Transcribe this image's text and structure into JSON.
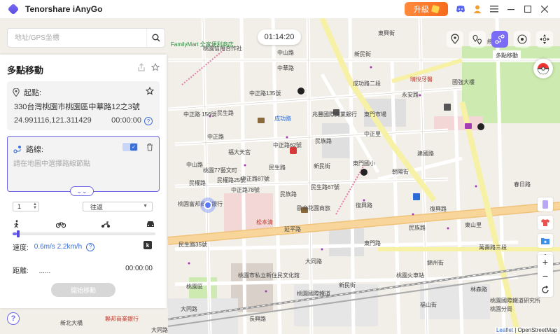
{
  "app": {
    "title": "Tenorshare iAnyGo",
    "upgrade_label": "升級"
  },
  "search": {
    "placeholder": "地址/GPS坐標"
  },
  "timer": "01:14:20",
  "panel": {
    "title": "多點移動",
    "start": {
      "label": "起點:",
      "address": "330台灣桃園市桃園區中華路12之3號",
      "coords": "24.991116,121.311429",
      "time": "00:00:00"
    },
    "route": {
      "label": "路線:",
      "hint": "請在地圖中選擇路線節點"
    },
    "loop_count": "1",
    "mode_select": "往返",
    "speed_label": "速度:",
    "speed_value": "0.6m/s 2.2km/h",
    "speed_level": 0.03,
    "distance_label": "距離:",
    "distance_value": "......",
    "distance_time": "00:00:00",
    "start_button": "開始移動"
  },
  "tooltip": "多點移動",
  "attribution": {
    "leaflet": "Leaflet",
    "rest": " | OpenStreetMap"
  },
  "map_labels": {
    "l1": "民生路",
    "l2": "中山路",
    "l3": "中正路 156號",
    "l4": "中正路135號",
    "l5": "成功路",
    "l6": "民族路",
    "l7": "中正路62號",
    "l8": "中正路",
    "l9": "民生路",
    "l10": "復興路",
    "l11": "新民街",
    "l12": "大同路",
    "l13": "桃園信用合作社",
    "l14": "桃園77藝文町",
    "l15": "福大天宮",
    "l16": "桃園富邦商業銀行",
    "l17": "松本清",
    "l18": "歐帝花園商旅",
    "l19": "民生路67號",
    "l20": "民生路35號",
    "l21": "兆豐國際商業銀行",
    "l22": "東門國小",
    "l23": "晴悅牙醫",
    "l24": "東山里",
    "l25": "萬壽路三段",
    "l26": "林森路",
    "l27": "桃園火車站",
    "l28": "桃園國際鐵道研究所",
    "l29": "中山路",
    "l30": "新民街",
    "l31": "民族路",
    "l32": "大同路",
    "l33": "復興路",
    "l34": "建國路",
    "l35": "東門路",
    "l36": "朝陽街",
    "l37": "春日路",
    "l38": "中華路",
    "l39": "總統府",
    "l40": "東興街",
    "l41": "成功路二段",
    "l42": "長興路",
    "l43": "新民街",
    "l44": "福山街",
    "l45": "延平路",
    "l46": "永安路",
    "l47": "中正路87號",
    "l48": "中正路78號",
    "l49": "民權路",
    "l50": "新北大橋",
    "l51": "聯邦商業銀行",
    "l52": "桃園區",
    "l53": "桃園國際鐵道",
    "l54": "大同路",
    "l55": "桃園市私立新住民文化館",
    "l56": "民權路25號",
    "l57": "錦州街",
    "l58": "東門市場",
    "l59": "中正里",
    "l60": "桃園分局",
    "l61": "國強大樓",
    "l62": "FamilyMart 全家便利商店"
  }
}
